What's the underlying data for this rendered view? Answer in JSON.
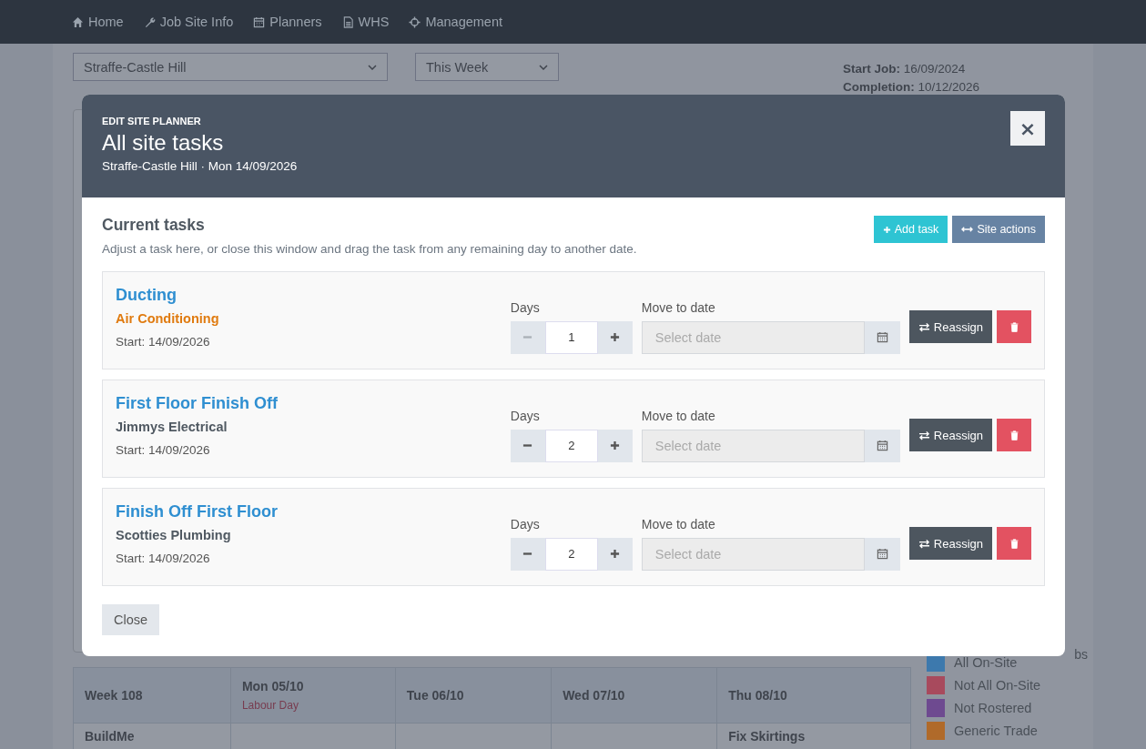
{
  "nav": [
    {
      "label": "Home"
    },
    {
      "label": "Job Site Info"
    },
    {
      "label": "Planners"
    },
    {
      "label": "WHS"
    },
    {
      "label": "Management"
    }
  ],
  "filters": {
    "site": "Straffe-Castle Hill",
    "period": "This Week"
  },
  "job_info": [
    {
      "label": "Start Job:",
      "value": "16/09/2024"
    },
    {
      "label": "Completion:",
      "value": "10/12/2026"
    }
  ],
  "side_heading": "bs",
  "week_table": {
    "columns": [
      {
        "title": "Week 108"
      },
      {
        "title": "Mon 05/10",
        "note": "Labour Day"
      },
      {
        "title": "Tue 06/10"
      },
      {
        "title": "Wed 07/10"
      },
      {
        "title": "Thu 08/10"
      }
    ],
    "rows": [
      {
        "cells": [
          "BuildMe",
          "",
          "",
          "",
          "Fix Skirtings"
        ]
      }
    ]
  },
  "legend": [
    {
      "label": "All On-Site",
      "color": "#3d79ad"
    },
    {
      "label": "Not All On-Site",
      "color": "#a84a5d"
    },
    {
      "label": "Not Rostered",
      "color": "#6e4a90"
    },
    {
      "label": "Generic Trade",
      "color": "#b06a2a"
    }
  ],
  "modal": {
    "kicker": "EDIT SITE PLANNER",
    "title": "All site tasks",
    "subtitle": "Straffe-Castle Hill · Mon 14/09/2026",
    "close_icon": "×",
    "section_title": "Current tasks",
    "help": "Adjust a task here, or close this window and drag the task from any remaining day to another date.",
    "actions": [
      {
        "kind": "add",
        "label": "Add task"
      },
      {
        "kind": "site",
        "label": "Site actions"
      }
    ],
    "tasks": [
      {
        "title": "Ducting",
        "trade": "Air Conditioning",
        "color": "#e07b10",
        "start": "Start: 14/09/2026",
        "days_label": "Days",
        "days": "1",
        "minus_disabled": true,
        "date_label": "Move to date",
        "date_placeholder": "Select date",
        "reassign": "Reassign"
      },
      {
        "title": "First Floor Finish Off",
        "trade": "Jimmys Electrical",
        "color": "#505962",
        "start": "Start: 14/09/2026",
        "days_label": "Days",
        "days": "2",
        "minus_disabled": false,
        "date_label": "Move to date",
        "date_placeholder": "Select date",
        "reassign": "Reassign"
      },
      {
        "title": "Finish Off First Floor",
        "trade": "Scotties Plumbing",
        "color": "#505962",
        "start": "Start: 14/09/2026",
        "days_label": "Days",
        "days": "2",
        "minus_disabled": false,
        "date_label": "Move to date",
        "date_placeholder": "Select date",
        "reassign": "Reassign"
      }
    ],
    "close_button": "Close"
  }
}
